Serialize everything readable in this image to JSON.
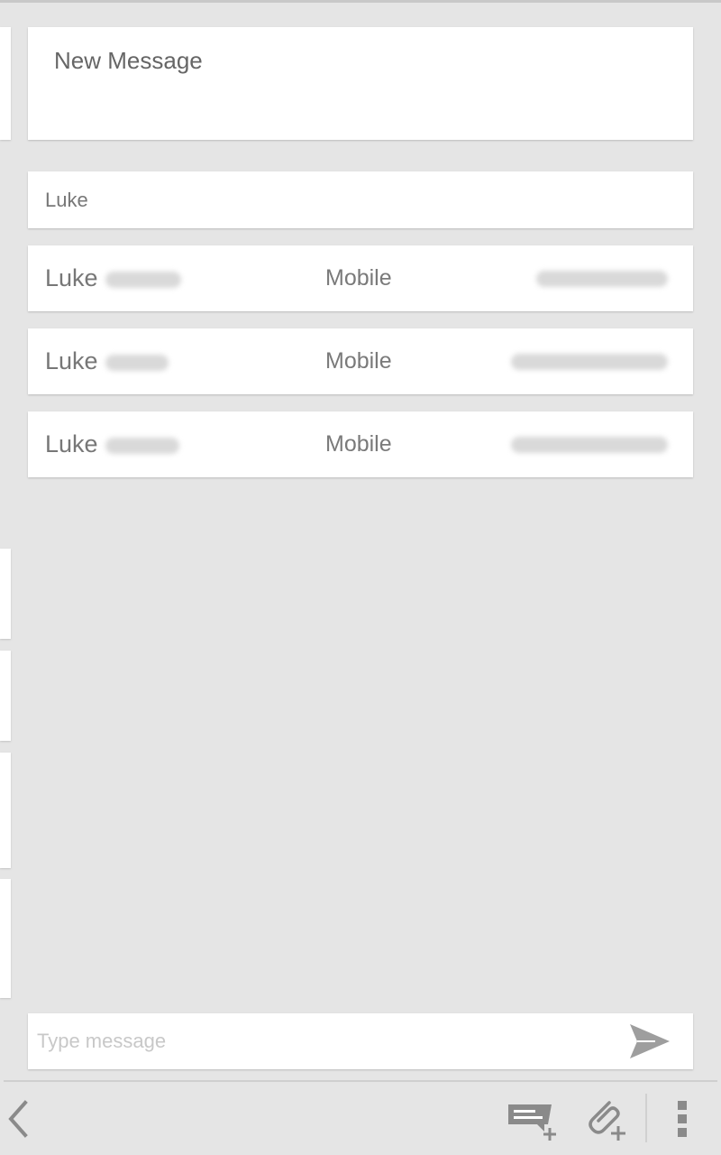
{
  "header": {
    "title": "New Message"
  },
  "recipient": {
    "value": "Luke"
  },
  "suggestions": [
    {
      "first_name": "Luke",
      "type": "Mobile"
    },
    {
      "first_name": "Luke",
      "type": "Mobile"
    },
    {
      "first_name": "Luke",
      "type": "Mobile"
    }
  ],
  "compose": {
    "placeholder": "Type message"
  },
  "icons": {
    "send": "send-icon",
    "back": "back-chevron-icon",
    "quick_text": "quick-text-add-icon",
    "attach": "attachment-add-icon",
    "overflow": "overflow-menu-icon"
  },
  "colors": {
    "background": "#e5e5e5",
    "card": "#ffffff",
    "icon_gray": "#8a8a8a",
    "text_gray": "#777777"
  }
}
